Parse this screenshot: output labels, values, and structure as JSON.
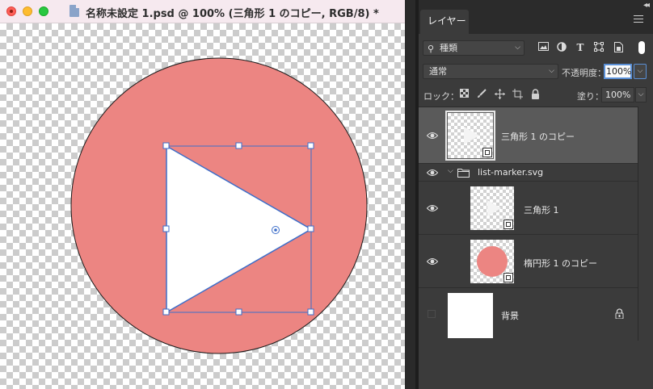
{
  "window": {
    "title": "名称未設定 1.psd @ 100% (三角形 1 のコピー, RGB/8) *"
  },
  "canvas": {
    "circle_color": "#ec8582",
    "triangle_color": "#ffffff",
    "selection_color": "#3d6ec9"
  },
  "panel": {
    "tab_label": "レイヤー",
    "filter_kind": "種類",
    "blend_mode": "通常",
    "opacity_label": "不透明度：",
    "opacity_value": "100%",
    "lock_label": "ロック：",
    "fill_label": "塗り：",
    "fill_value": "100%"
  },
  "layers": [
    {
      "name": "三角形 1 のコピー",
      "visible": true,
      "selected": true,
      "type": "smart-object"
    },
    {
      "name": "list-marker.svg",
      "visible": true,
      "selected": false,
      "type": "group",
      "expanded": true
    },
    {
      "name": "三角形 1",
      "visible": true,
      "selected": false,
      "type": "smart-object"
    },
    {
      "name": "楕円形 1 のコピー",
      "visible": true,
      "selected": false,
      "type": "smart-object"
    },
    {
      "name": "背景",
      "visible": false,
      "selected": false,
      "type": "background",
      "locked": true
    }
  ]
}
